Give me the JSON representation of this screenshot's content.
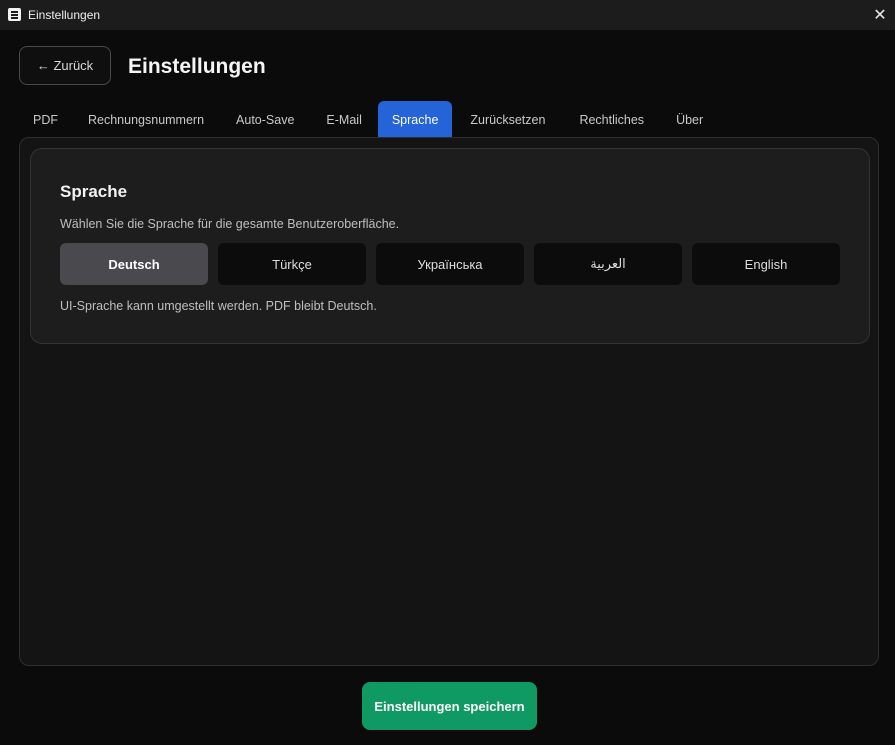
{
  "window": {
    "title": "Einstellungen",
    "close_glyph": "✕"
  },
  "header": {
    "back_label": "← Zurück",
    "title": "Einstellungen"
  },
  "tabs": [
    {
      "label": "PDF"
    },
    {
      "label": "Rechnungsnummern"
    },
    {
      "label": "Auto-Save"
    },
    {
      "label": "E-Mail"
    },
    {
      "label": "Sprache",
      "active": true
    },
    {
      "label": "Zurücksetzen"
    },
    {
      "label": "Rechtliches"
    },
    {
      "label": "Über"
    }
  ],
  "language_section": {
    "title": "Sprache",
    "description": "Wählen Sie die Sprache für die gesamte Benutzeroberfläche.",
    "options": [
      {
        "label": "Deutsch",
        "selected": true
      },
      {
        "label": "Türkçe"
      },
      {
        "label": "Українська"
      },
      {
        "label": "العربية"
      },
      {
        "label": "English"
      }
    ],
    "note": "UI-Sprache kann umgestellt werden. PDF bleibt Deutsch."
  },
  "footer": {
    "save_label": "Einstellungen speichern"
  },
  "colors": {
    "accent_tab": "#2563d8",
    "save_button": "#0f9a63",
    "background": "#0b0b0b"
  }
}
